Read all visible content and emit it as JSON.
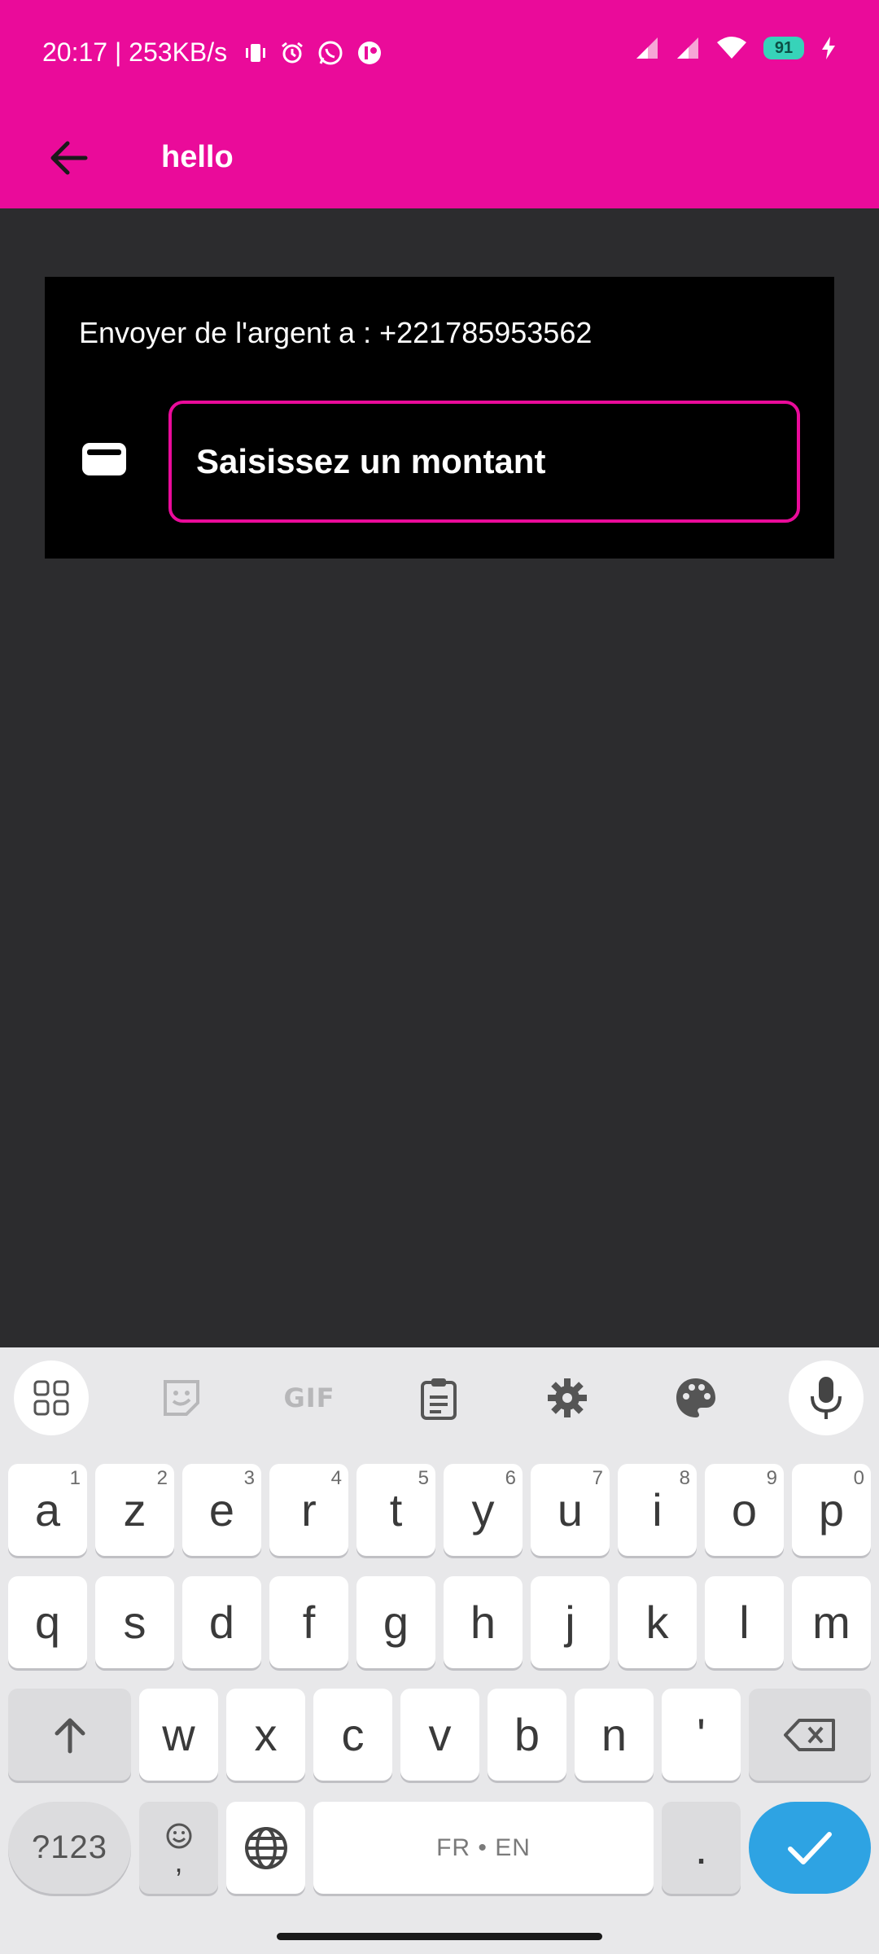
{
  "status_bar": {
    "time_speed": "20:17 | 253KB/s",
    "battery": "91"
  },
  "app_bar": {
    "title": "hello"
  },
  "send_card": {
    "label": "Envoyer de l'argent a : +221785953562",
    "amount_placeholder": "Saisissez un montant"
  },
  "keyboard": {
    "gif_label": "GIF",
    "row1": [
      {
        "key": "a",
        "hint": "1"
      },
      {
        "key": "z",
        "hint": "2"
      },
      {
        "key": "e",
        "hint": "3"
      },
      {
        "key": "r",
        "hint": "4"
      },
      {
        "key": "t",
        "hint": "5"
      },
      {
        "key": "y",
        "hint": "6"
      },
      {
        "key": "u",
        "hint": "7"
      },
      {
        "key": "i",
        "hint": "8"
      },
      {
        "key": "o",
        "hint": "9"
      },
      {
        "key": "p",
        "hint": "0"
      }
    ],
    "row2": [
      "q",
      "s",
      "d",
      "f",
      "g",
      "h",
      "j",
      "k",
      "l",
      "m"
    ],
    "row3": [
      "w",
      "x",
      "c",
      "v",
      "b",
      "n",
      "'"
    ],
    "symbols_label": "?123",
    "comma_label": ",",
    "space_label": "FR • EN",
    "period_label": "."
  },
  "colors": {
    "accent": "#ea0b9a",
    "background": "#2c2c2e",
    "enter_key": "#2ea3e3"
  }
}
